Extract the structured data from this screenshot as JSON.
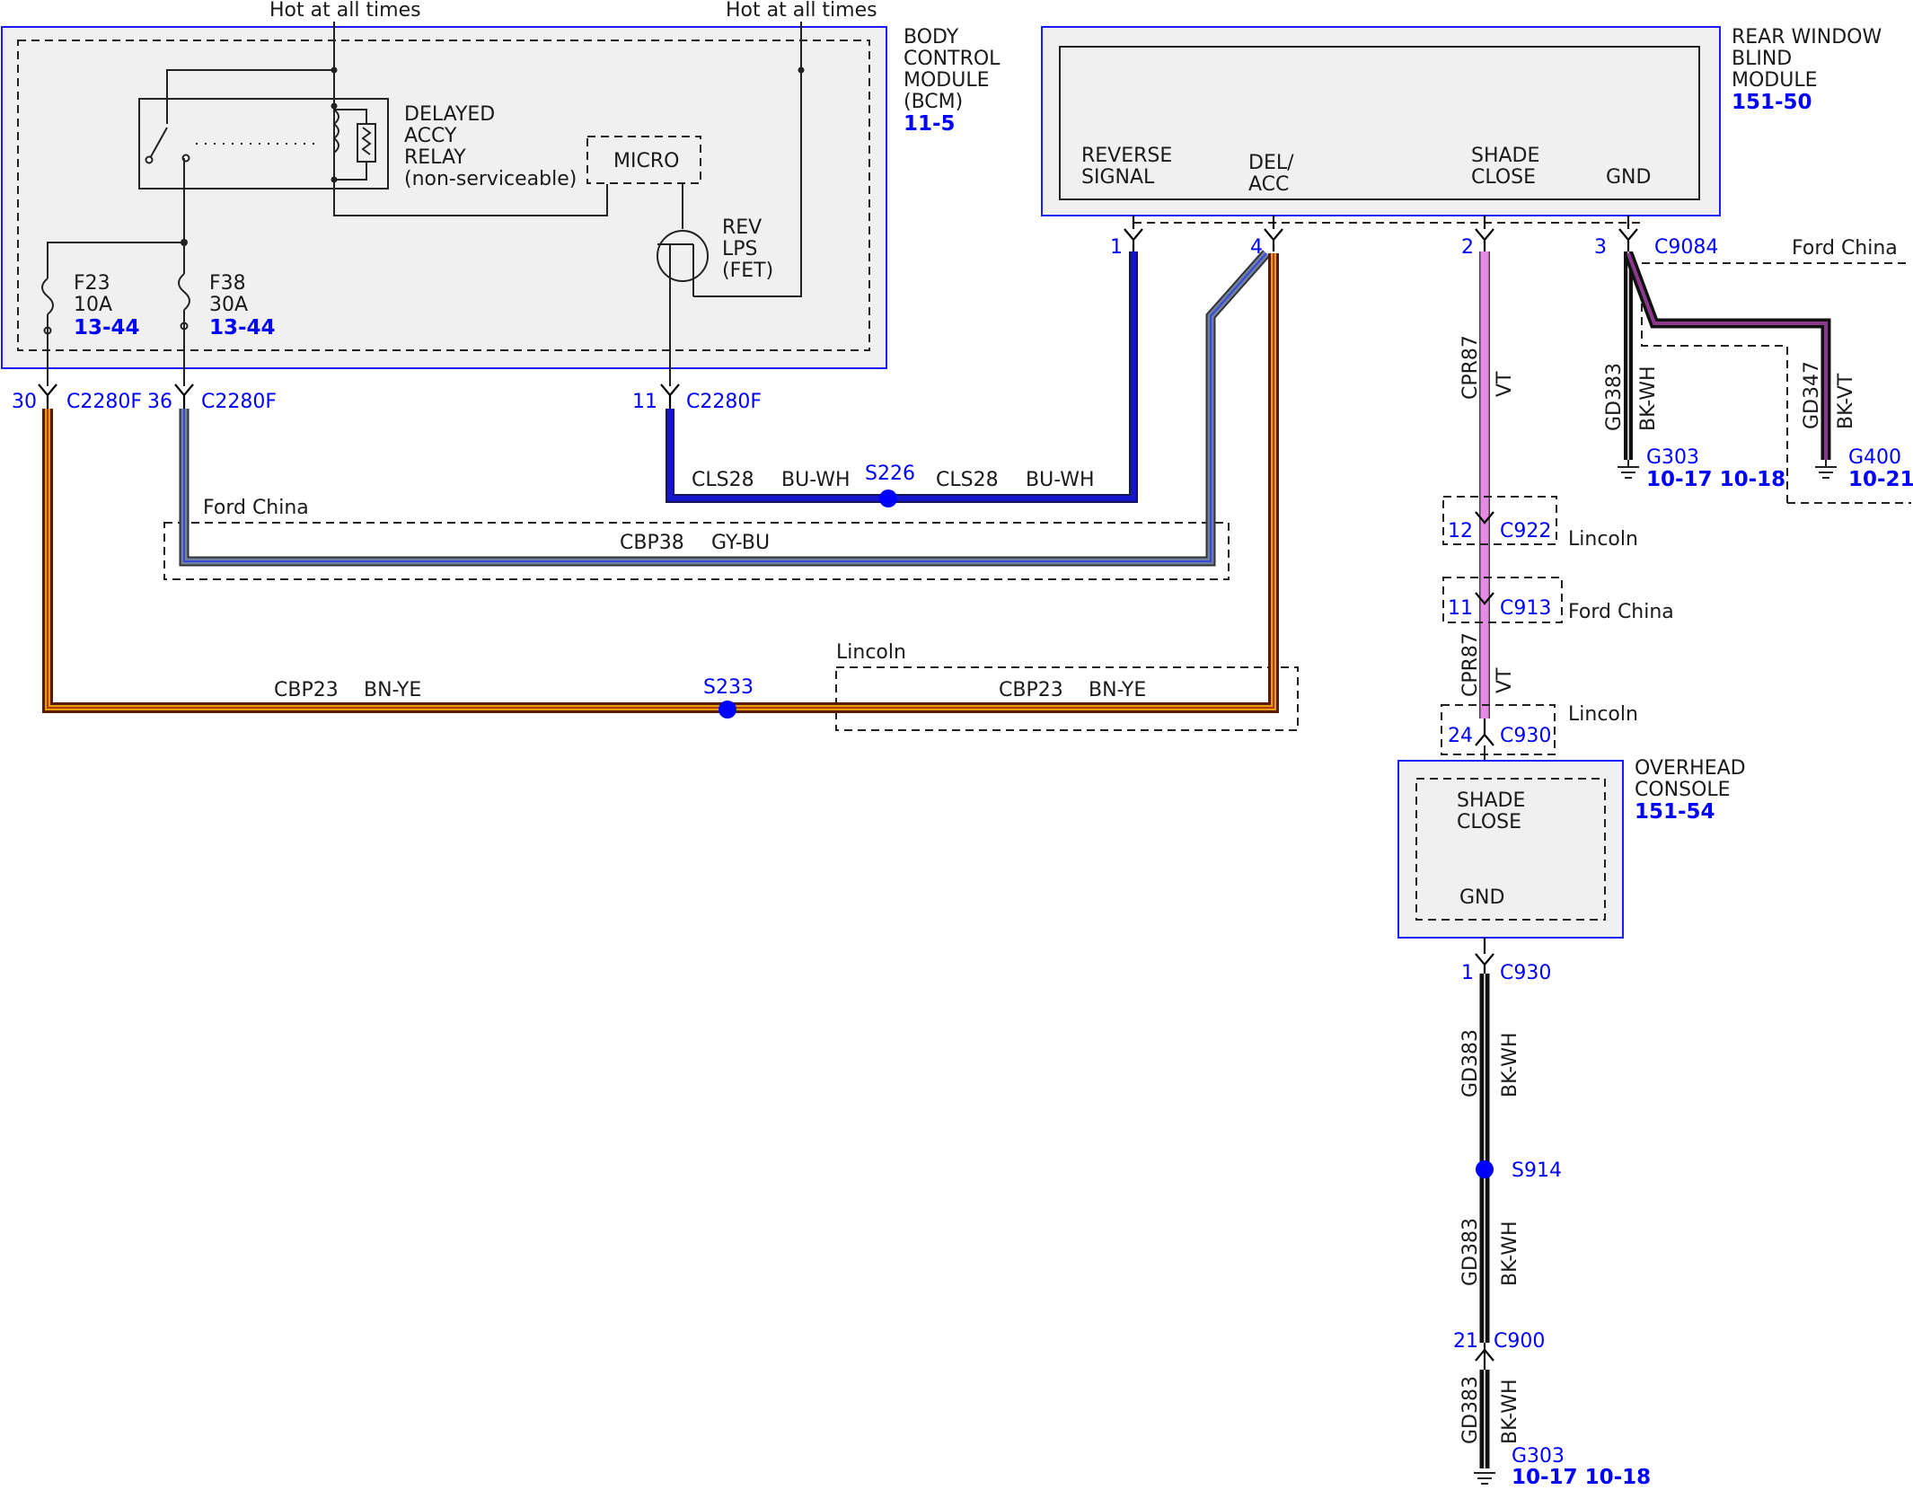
{
  "hot": [
    "Hot at all times",
    "Hot at all times"
  ],
  "bcm": {
    "name": [
      "BODY",
      "CONTROL",
      "MODULE",
      "(BCM)"
    ],
    "ref": "11-5",
    "relay": [
      "DELAYED",
      "ACCY",
      "RELAY",
      "(non-serviceable)"
    ],
    "micro": "MICRO",
    "fet": [
      "REV",
      "LPS",
      "(FET)"
    ],
    "fuses": [
      {
        "id": "F23",
        "amps": "10A",
        "ref": "13-44"
      },
      {
        "id": "F38",
        "amps": "30A",
        "ref": "13-44"
      }
    ],
    "pins": [
      {
        "pin": "30",
        "connector": "C2280F"
      },
      {
        "pin": "36",
        "connector": "C2280F"
      },
      {
        "pin": "11",
        "connector": "C2280F"
      }
    ]
  },
  "rwbm": {
    "name": [
      "REAR WINDOW",
      "BLIND",
      "MODULE"
    ],
    "ref": "151-50",
    "terminals": [
      {
        "label": [
          "REVERSE",
          "SIGNAL"
        ],
        "pin": "1"
      },
      {
        "label": [
          "DEL/",
          "ACC"
        ],
        "pin": "4"
      },
      {
        "label": [
          "SHADE",
          "CLOSE"
        ],
        "pin": "2"
      },
      {
        "label": [
          "GND"
        ],
        "pin": "3"
      }
    ],
    "connector": "C9084"
  },
  "wires": {
    "cls28": {
      "circuit": "CLS28",
      "color": "BU-WH"
    },
    "cbp38": {
      "circuit": "CBP38",
      "color": "GY-BU"
    },
    "cbp23": {
      "circuit": "CBP23",
      "color": "BN-YE"
    },
    "cpr87": {
      "circuit": "CPR87",
      "color": "VT"
    },
    "gd383": {
      "circuit": "GD383",
      "color": "BK-WH"
    },
    "gd347": {
      "circuit": "GD347",
      "color": "BK-VT"
    }
  },
  "splices": {
    "s226": "S226",
    "s233": "S233",
    "s914": "S914"
  },
  "options": {
    "ford_china": "Ford China",
    "lincoln": "Lincoln"
  },
  "inline": [
    {
      "pin": "12",
      "connector": "C922"
    },
    {
      "pin": "11",
      "connector": "C913"
    },
    {
      "pin": "24",
      "connector": "C930"
    },
    {
      "pin": "1",
      "connector": "C930"
    },
    {
      "pin": "21",
      "connector": "C900"
    }
  ],
  "grounds": {
    "g303": {
      "name": "G303",
      "refs": "10-17 10-18"
    },
    "g400": {
      "name": "G400",
      "refs": "10-21"
    }
  },
  "overhead": {
    "name": [
      "OVERHEAD",
      "CONSOLE"
    ],
    "ref": "151-54",
    "terminals": [
      [
        "SHADE",
        "CLOSE"
      ],
      [
        "GND"
      ]
    ]
  },
  "colors": {
    "module_border": "#1a1aff",
    "module_fill": "#f0f0f0",
    "label_blue": "#0000ff",
    "blue_wire": "#1515cc",
    "gray_blue_wire": "#6e7fa0",
    "brown_yellow_wire": "#8b2e0a",
    "violet_wire": "#e48be4",
    "black_wire": "#111111"
  }
}
